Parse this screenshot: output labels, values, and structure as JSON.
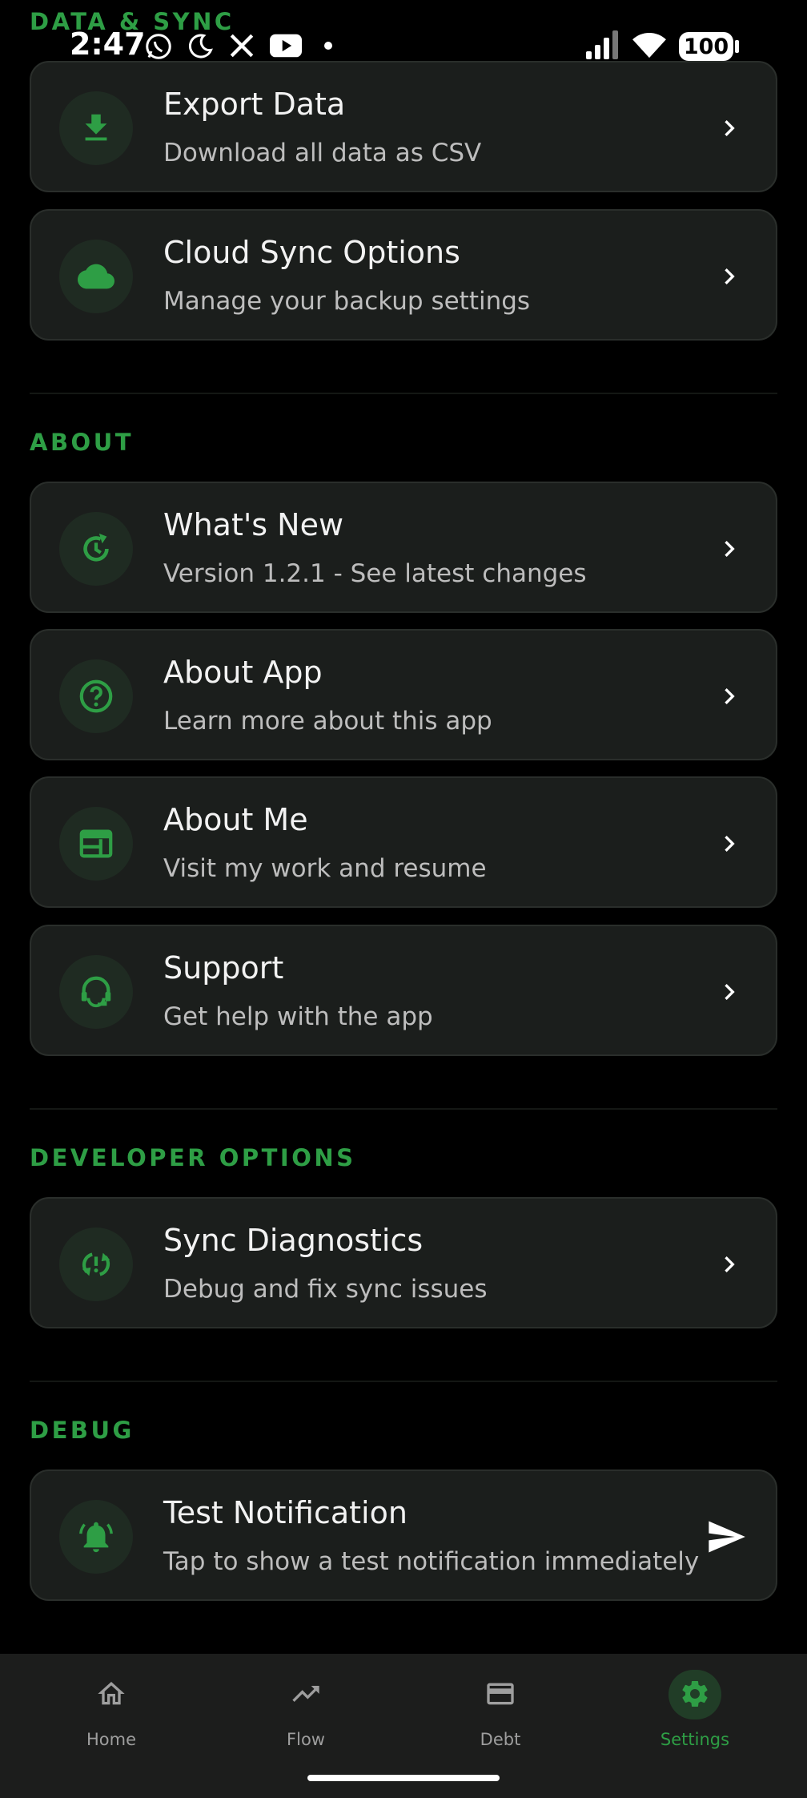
{
  "status_bar": {
    "time": "2:47",
    "battery": "100"
  },
  "sections": {
    "data_sync": "DATA & SYNC",
    "about": "ABOUT",
    "developer": "DEVELOPER OPTIONS",
    "debug": "DEBUG"
  },
  "items": {
    "export": {
      "title": "Export Data",
      "subtitle": "Download all data as CSV",
      "icon": "download-icon"
    },
    "cloud": {
      "title": "Cloud Sync Options",
      "subtitle": "Manage your backup settings",
      "icon": "cloud-icon"
    },
    "whats_new": {
      "title": "What's New",
      "subtitle": "Version 1.2.1 - See latest changes",
      "icon": "update-icon"
    },
    "about_app": {
      "title": "About App",
      "subtitle": "Learn more about this app",
      "icon": "help-icon"
    },
    "about_me": {
      "title": "About Me",
      "subtitle": "Visit my work and resume",
      "icon": "web-icon"
    },
    "support": {
      "title": "Support",
      "subtitle": "Get help with the app",
      "icon": "support-agent-icon"
    },
    "sync_diag": {
      "title": "Sync Diagnostics",
      "subtitle": "Debug and fix sync issues",
      "icon": "sync-problem-icon"
    },
    "test_notif": {
      "title": "Test Notification",
      "subtitle": "Tap to show a test notification immediately",
      "icon": "bell-icon"
    }
  },
  "nav": {
    "home": "Home",
    "flow": "Flow",
    "debt": "Debt",
    "settings": "Settings",
    "active": "Settings"
  },
  "colors": {
    "accent": "#2e9e45",
    "card_bg": "#1b1e1c",
    "background": "#000000",
    "nav_bg": "#1c1d1c"
  }
}
